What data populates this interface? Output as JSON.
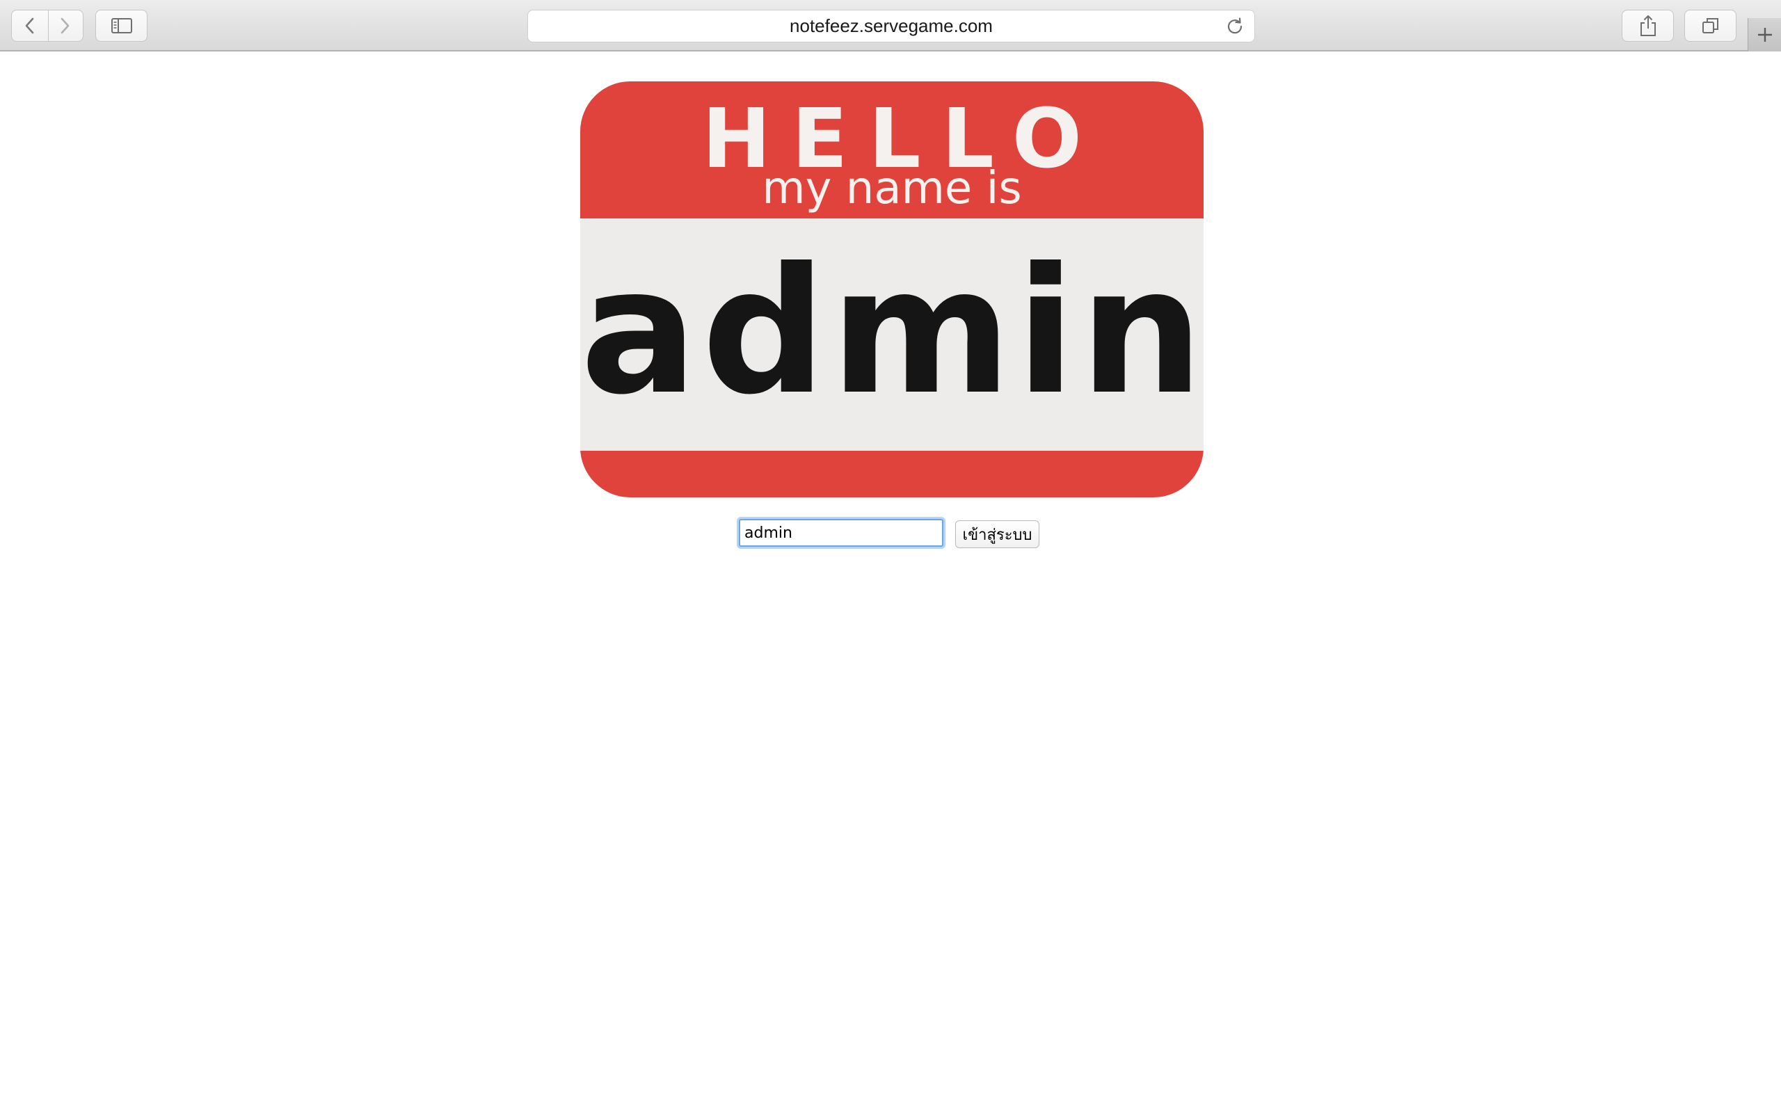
{
  "browser": {
    "url": "notefeez.servegame.com",
    "buttons": {
      "back": "chevron-left-icon",
      "forward": "chevron-right-icon",
      "sidebar": "sidebar-icon",
      "reload": "reload-icon",
      "share": "share-icon",
      "tabs": "tabs-overview-icon",
      "new_tab": "plus-icon"
    }
  },
  "badge": {
    "hello": "HELLO",
    "subtitle": "my name is",
    "name": "admin",
    "colors": {
      "red": "#e0433b",
      "panel": "#edeceb",
      "ink": "#151515"
    }
  },
  "login": {
    "input_value": "admin",
    "submit_label": "เข้าสู่ระบบ"
  }
}
